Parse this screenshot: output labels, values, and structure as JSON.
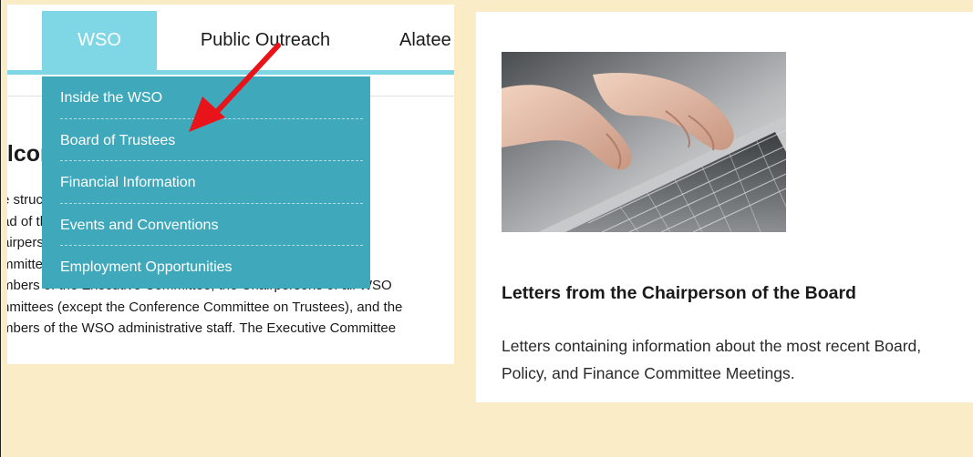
{
  "nav": {
    "tabs": [
      {
        "label": "WSO"
      },
      {
        "label": "Public Outreach"
      },
      {
        "label": "Alatee"
      }
    ]
  },
  "dropdown": {
    "items": [
      {
        "label": "Inside the WSO"
      },
      {
        "label": "Board of Trustees"
      },
      {
        "label": "Financial Information"
      },
      {
        "label": "Events and Conventions"
      },
      {
        "label": "Employment Opportunities"
      }
    ]
  },
  "main": {
    "heading": "elcome to the WSO page!",
    "lines": [
      "e structure of the World Service Office includes an Executive",
      "ad of the Executive Director and the team of paid employees",
      "airpersons and staff members of WSO volunteers. The WSO",
      "mmittees report to the Executive Director of the Board",
      "mbers of the Executive Committee, the Chairpersons of all WSO",
      "nmittees (except the Conference Committee on Trustees), and the",
      "mbers of the WSO administrative staff. The Executive Committee"
    ]
  },
  "card": {
    "image_alt": "hands-typing-on-laptop-keyboard",
    "title": "Letters from the Chairperson of the Board",
    "description": "Letters containing information about the most recent Board, Policy, and Finance Committee Meetings."
  },
  "colors": {
    "page_bg": "#fbecc8",
    "nav_accent": "#7fd7e6",
    "dropdown_bg": "#3fa8bb",
    "arrow": "#e8141a"
  },
  "annotation": {
    "icon": "red-arrow-icon"
  }
}
